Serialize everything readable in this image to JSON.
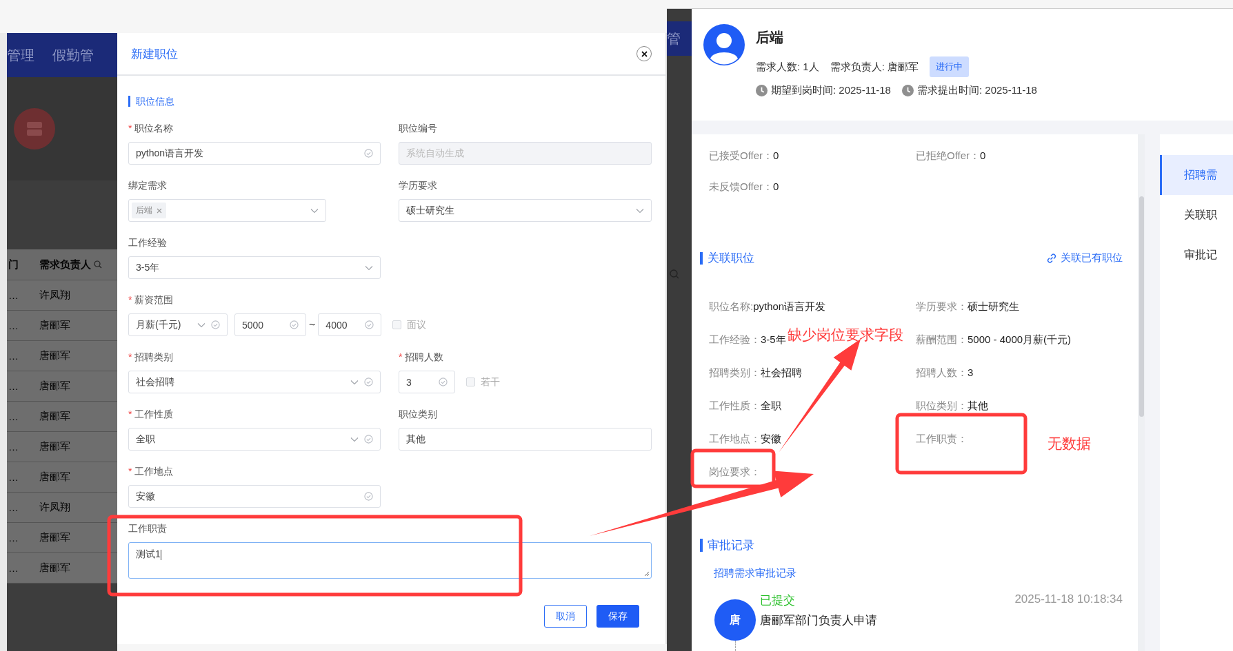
{
  "background_app": {
    "nav_items": [
      "管理",
      "假勤管"
    ],
    "table": {
      "columns": [
        "门",
        "需求负责人"
      ],
      "rows": [
        [
          "…",
          "许凤翔"
        ],
        [
          "…",
          "唐郦军"
        ],
        [
          "…",
          "唐郦军"
        ],
        [
          "…",
          "唐郦军"
        ],
        [
          "…",
          "唐郦军"
        ],
        [
          "…",
          "唐郦军"
        ],
        [
          "…",
          "唐郦军"
        ],
        [
          "…",
          "许凤翔"
        ],
        [
          "…",
          "唐郦军"
        ],
        [
          "…",
          "唐郦军"
        ]
      ]
    },
    "right_nav_item": "管"
  },
  "dialog": {
    "title": "新建职位",
    "section": "职位信息",
    "fields": [
      {
        "kind": "input",
        "label": "职位名称",
        "required_mark": "*",
        "value": "python语言开发",
        "valid": true
      },
      {
        "kind": "input",
        "label": "职位编号",
        "placeholder": "系统自动生成",
        "disabled": true
      },
      {
        "kind": "tags",
        "label": "绑定需求",
        "tags": [
          "后端"
        ]
      },
      {
        "kind": "select",
        "label": "学历要求",
        "value": "硕士研究生",
        "valid": false
      },
      {
        "kind": "select",
        "label": "工作经验",
        "value": "3-5年",
        "valid": false
      },
      {
        "kind": "salary",
        "label": "薪资范围",
        "required_mark": "*",
        "unit": "月薪(千元)",
        "min": "5000",
        "separator": "~",
        "max": "4000",
        "negotiable": {
          "label": "面议",
          "checked": false
        }
      },
      {
        "kind": "select",
        "label": "招聘类别",
        "required_mark": "*",
        "value": "社会招聘",
        "valid": true
      },
      {
        "kind": "count",
        "label": "招聘人数",
        "required_mark": "*",
        "value": "3",
        "several": {
          "label": "若干",
          "checked": false
        }
      },
      {
        "kind": "select",
        "label": "工作性质",
        "required_mark": "*",
        "value": "全职",
        "valid": true
      },
      {
        "kind": "input",
        "label": "职位类别",
        "value": "其他",
        "valid": false
      },
      {
        "kind": "input",
        "label": "工作地点",
        "required_mark": "*",
        "value": "安徽",
        "valid": true
      },
      {
        "kind": "textarea",
        "label": "工作职责",
        "value": "测试1",
        "focused": true
      }
    ],
    "buttons": [
      {
        "label": "取消",
        "kind": "secondary"
      },
      {
        "label": "保存",
        "kind": "primary"
      }
    ]
  },
  "detail": {
    "title": "后端",
    "meta": [
      "需求人数: 1人",
      "需求负责人: 唐郦军"
    ],
    "status": {
      "label": "进行中",
      "kind": "in_progress"
    },
    "dates": [
      "期望到岗时间: 2025-11-18",
      "需求提出时间: 2025-11-18"
    ],
    "offers": [
      {
        "label": "已接受Offer：",
        "value": "0"
      },
      {
        "label": "已拒绝Offer：",
        "value": "0"
      },
      {
        "label": "未反馈Offer：",
        "value": "0"
      }
    ],
    "linked_position": {
      "title": "关联职位",
      "link": "关联已有职位",
      "fields": [
        {
          "label": "职位名称:",
          "value": "python语言开发"
        },
        {
          "label": "学历要求：",
          "value": "硕士研究生"
        },
        {
          "label": "工作经验：",
          "value": "3-5年"
        },
        {
          "label": "薪酬范围：",
          "value": "5000 - 4000月薪(千元)"
        },
        {
          "label": "招聘类别：",
          "value": "社会招聘"
        },
        {
          "label": "招聘人数：",
          "value": "3"
        },
        {
          "label": "工作性质：",
          "value": "全职"
        },
        {
          "label": "职位类别：",
          "value": "其他"
        },
        {
          "label": "工作地点：",
          "value": "安徽"
        },
        {
          "label": "工作职责："
        },
        {
          "label": "岗位要求："
        }
      ]
    },
    "approval": {
      "title": "审批记录",
      "subtitle": "招聘需求审批记录",
      "entries": [
        {
          "avatar": "唐",
          "status": "已提交",
          "time": "2025-11-18 10:18:34",
          "text": "唐郦军部门负责人申请"
        }
      ]
    },
    "side_nav": [
      {
        "label": "招聘需",
        "selected": true
      },
      {
        "label": "关联职",
        "selected": false
      },
      {
        "label": "审批记",
        "selected": false
      }
    ]
  },
  "annotations": [
    {
      "text": "缺少岗位要求字段"
    },
    {
      "text": "无数据"
    }
  ]
}
